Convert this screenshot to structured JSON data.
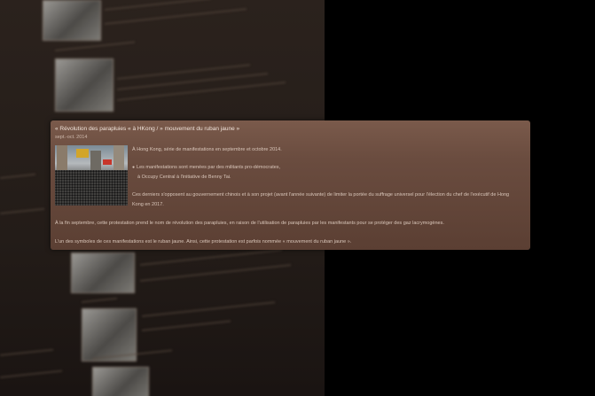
{
  "card": {
    "title": "« Révolution des parapluies « à HKong / » mouvement du ruban jaune »",
    "date": "sept.-oct. 2014",
    "line1": "À Hong Kong, série de manifestations en septembre et octobre 2014.",
    "bullet": "Les manifestations sont menées par des militants pro-démocrates,",
    "line3": "à Occupy Central à l'initiative de Benny Tai.",
    "line4": "Ces derniers s'opposent au gouvernement chinois et à son projet (avant l'année suivante) de limiter la portée du suffrage universel pour l'élection du chef de l'exécutif de Hong",
    "line5": "Kong en 2017.",
    "line6": "À la fin septembre, cette protestation prend le nom de révolution des parapluies, en raison de l'utilisation de parapluies par les manifestants pour se protéger des gaz lacrymogènes.",
    "line7": "L'un des symboles de ces manifestations est le ruban jaune. Ainsi, cette protestation est parfois nommée « mouvement du ruban jaune »."
  }
}
